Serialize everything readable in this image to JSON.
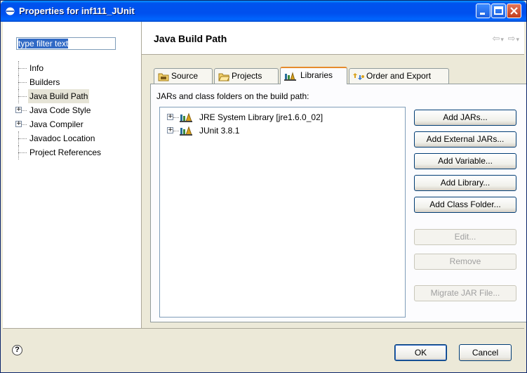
{
  "window": {
    "title": "Properties for inf111_JUnit",
    "icon": "eclipse-properties-icon",
    "controls": [
      "minimize-icon",
      "maximize-icon",
      "close-icon"
    ]
  },
  "left": {
    "filter_value": "type filter text",
    "tree": [
      {
        "label": "Info",
        "expandable": false,
        "selected": false
      },
      {
        "label": "Builders",
        "expandable": false,
        "selected": false
      },
      {
        "label": "Java Build Path",
        "expandable": false,
        "selected": true
      },
      {
        "label": "Java Code Style",
        "expandable": true,
        "selected": false
      },
      {
        "label": "Java Compiler",
        "expandable": true,
        "selected": false
      },
      {
        "label": "Javadoc Location",
        "expandable": false,
        "selected": false
      },
      {
        "label": "Project References",
        "expandable": false,
        "selected": false
      }
    ]
  },
  "page": {
    "title": "Java Build Path",
    "nav": {
      "back": "⇦",
      "forward": "⇨",
      "dropdown": "▾"
    }
  },
  "tabs": [
    {
      "label": "Source",
      "icon": "source-folder-icon",
      "active": false
    },
    {
      "label": "Projects",
      "icon": "projects-folder-icon",
      "active": false
    },
    {
      "label": "Libraries",
      "icon": "libraries-icon",
      "active": true
    },
    {
      "label": "Order and Export",
      "icon": "order-export-icon",
      "active": false
    }
  ],
  "libraries": {
    "caption": "JARs and class folders on the build path:",
    "items": [
      {
        "label": "JRE System Library [jre1.6.0_02]",
        "icon": "library-icon"
      },
      {
        "label": "JUnit 3.8.1",
        "icon": "library-icon"
      }
    ]
  },
  "buttons": [
    {
      "label": "Add JARs...",
      "enabled": true
    },
    {
      "label": "Add External JARs...",
      "enabled": true
    },
    {
      "label": "Add Variable...",
      "enabled": true
    },
    {
      "label": "Add Library...",
      "enabled": true
    },
    {
      "label": "Add Class Folder...",
      "enabled": true
    },
    {
      "label": "Edit...",
      "enabled": false
    },
    {
      "label": "Remove",
      "enabled": false
    },
    {
      "label": "Migrate JAR File...",
      "enabled": false
    }
  ],
  "footer": {
    "help": "?",
    "ok": "OK",
    "cancel": "Cancel"
  }
}
